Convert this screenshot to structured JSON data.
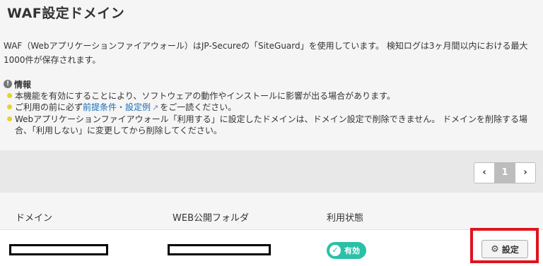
{
  "page": {
    "title": "WAF設定ドメイン",
    "intro": "WAF（Webアプリケーションファイアウォール）はJP-Secureの「SiteGuard」を使用しています。 検知ログは3ヶ月間以内における最大1000件が保存されます。"
  },
  "info": {
    "heading": "情報",
    "icon": "info-icon",
    "items": [
      {
        "text": "本機能を有効にすることにより、ソフトウェアの動作やインストールに影響が出る場合があります。"
      },
      {
        "pre": "ご利用の前に必ず",
        "link": "前提条件・設定例",
        "post": "をご一読ください。"
      },
      {
        "text": "Webアプリケーションファイアウォール「利用する」に設定したドメインは、ドメイン設定で削除できません。 ドメインを削除する場合、「利用しない」に変更してから削除してください。"
      }
    ]
  },
  "pager": {
    "prev": "‹",
    "current": "1",
    "next": "›"
  },
  "table": {
    "headers": {
      "domain": "ドメイン",
      "folder": "WEB公開フォルダ",
      "status": "利用状態"
    },
    "rows": [
      {
        "status": "有効",
        "action": "設定"
      }
    ]
  },
  "colors": {
    "accent": "#2bc0a8",
    "highlight": "#e0141e",
    "bullet": "#e5d32a",
    "link": "#1a6fb5"
  }
}
